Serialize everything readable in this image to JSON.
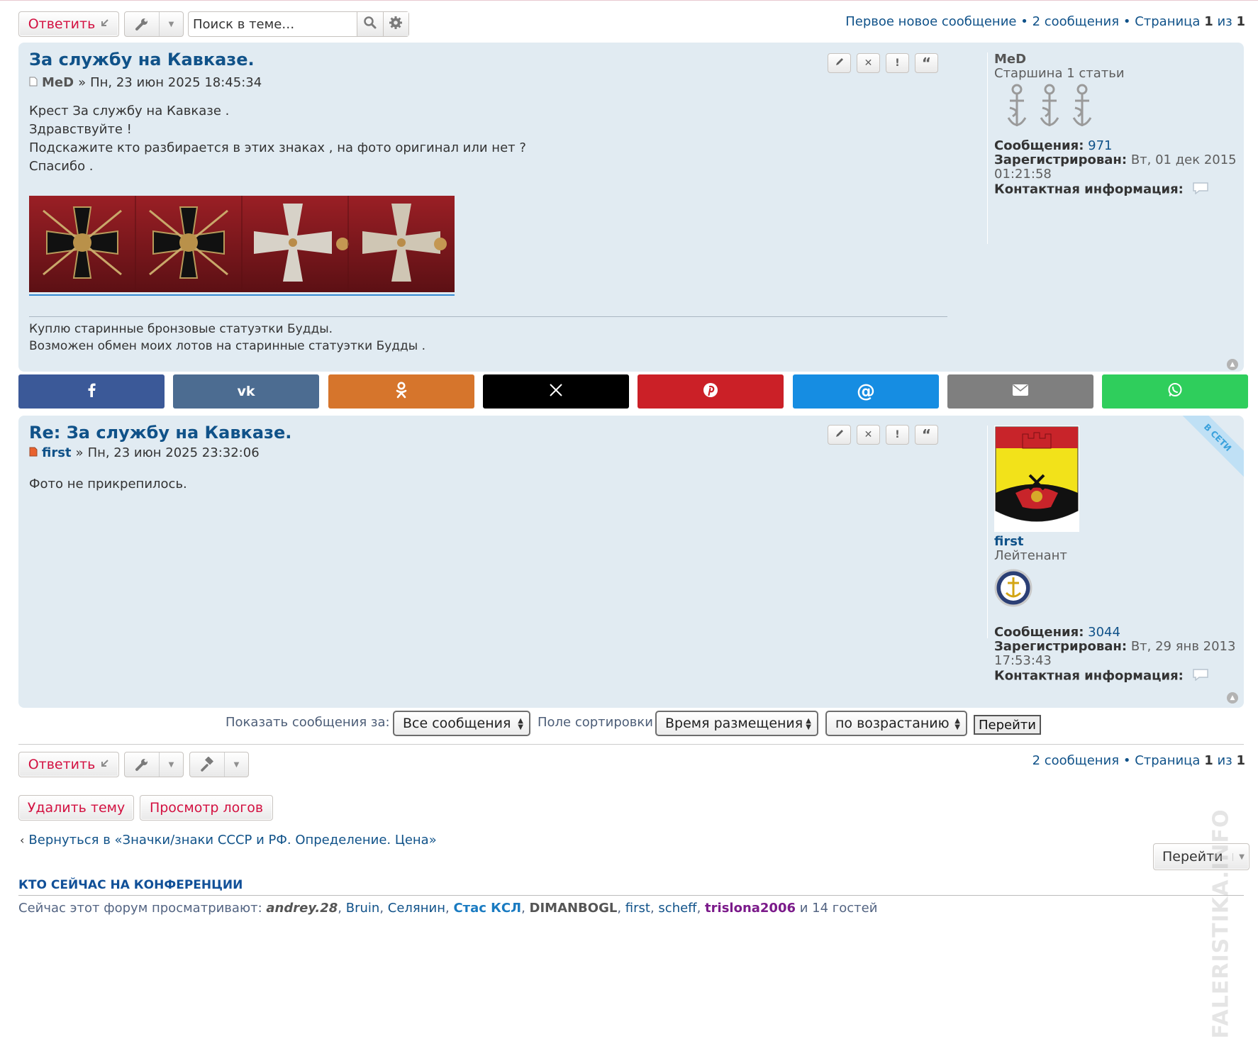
{
  "toolbar_top": {
    "reply_label": "Ответить",
    "search_placeholder": "Поиск в теме…",
    "pagination": {
      "first_new": "Первое новое сообщение",
      "sep": "•",
      "count": "2 сообщения",
      "page_word": "Страница",
      "page_current": "1",
      "of_word": "из",
      "page_total": "1"
    }
  },
  "posts": [
    {
      "title": "За службу на Кавказе.",
      "author": "MeD",
      "sep": "»",
      "date": "Пн, 23 июн 2025 18:45:34",
      "body": [
        "Крест За службу на Кавказе .",
        "Здравствуйте !",
        "Подскажите кто разбирается в этих знаках , на фото оригинал или нет ?",
        "Спасибо ."
      ],
      "signature": [
        "Куплю старинные бронзовые статуэтки Будды.",
        "Возможен обмен моих лотов на старинные статуэтки Будды ."
      ],
      "profile": {
        "name": "MeD",
        "rank": "Старшина 1 статьи",
        "posts_label": "Сообщения:",
        "posts_count": "971",
        "registered_label": "Зарегистрирован:",
        "registered_line1": "Вт, 01 дек 2015",
        "registered_line2": "01:21:58",
        "contact_label": "Контактная информация:"
      }
    },
    {
      "title": "Re: За службу на Кавказе.",
      "author": "first",
      "sep": "»",
      "date": "Пн, 23 июн 2025 23:32:06",
      "body": [
        "Фото не прикрепилось."
      ],
      "online_ribbon": "В СЕТИ",
      "profile": {
        "name": "first",
        "rank": "Лейтенант",
        "posts_label": "Сообщения:",
        "posts_count": "3044",
        "registered_label": "Зарегистрирован:",
        "registered_line1": "Вт, 29 янв 2013",
        "registered_line2": "17:53:43",
        "contact_label": "Контактная информация:"
      }
    }
  ],
  "share_bar": [
    {
      "icon": "facebook-icon",
      "color": "#3b5998"
    },
    {
      "icon": "vk-icon",
      "color": "#4c6c91"
    },
    {
      "icon": "odnoklassniki-icon",
      "color": "#d6752c"
    },
    {
      "icon": "x-twitter-icon",
      "color": "#000000"
    },
    {
      "icon": "pinterest-icon",
      "color": "#cb2027"
    },
    {
      "icon": "mail-ru-icon",
      "color": "#168de2"
    },
    {
      "icon": "email-icon",
      "color": "#7f7f7f"
    },
    {
      "icon": "whatsapp-icon",
      "color": "#2fce5c"
    }
  ],
  "display_options": {
    "show_label": "Показать сообщения за:",
    "show_value": "Все сообщения",
    "sort_label": "Поле сортировки",
    "sort_value": "Время размещения",
    "direction_value": "по возрастанию",
    "go_label": "Перейти"
  },
  "toolbar_bottom": {
    "reply_label": "Ответить",
    "pagination": {
      "count": "2 сообщения",
      "sep": "•",
      "page_word": "Страница",
      "page_current": "1",
      "of_word": "из",
      "page_total": "1"
    }
  },
  "mod_buttons": {
    "delete_topic": "Удалить тему",
    "view_logs": "Просмотр логов"
  },
  "back_link": "Вернуться в «Значки/знаки СССР и РФ. Определение. Цена»",
  "jump_label": "Перейти",
  "who_online": {
    "heading": "КТО СЕЙЧАС НА КОНФЕРЕНЦИИ",
    "prefix": "Сейчас этот форум просматривают:",
    "users": [
      {
        "name": "andrey.28",
        "color": "#555555",
        "style": "bold-italic"
      },
      {
        "name": "Bruin",
        "color": "#105289",
        "style": "normal"
      },
      {
        "name": "Селянин",
        "color": "#105289",
        "style": "normal"
      },
      {
        "name": "Стас КСЛ",
        "color": "#1a7bc1",
        "style": "bold"
      },
      {
        "name": "DIMANBOGL",
        "color": "#555555",
        "style": "bold"
      },
      {
        "name": "first",
        "color": "#105289",
        "style": "normal"
      },
      {
        "name": "scheff",
        "color": "#105289",
        "style": "normal"
      },
      {
        "name": "trislona2006",
        "color": "#7b1a8a",
        "style": "bold"
      }
    ],
    "suffix": "и 14 гостей"
  },
  "colors": {
    "link": "#105289",
    "post_bg": "#e1ebf2",
    "reply_red": "#d31141"
  }
}
